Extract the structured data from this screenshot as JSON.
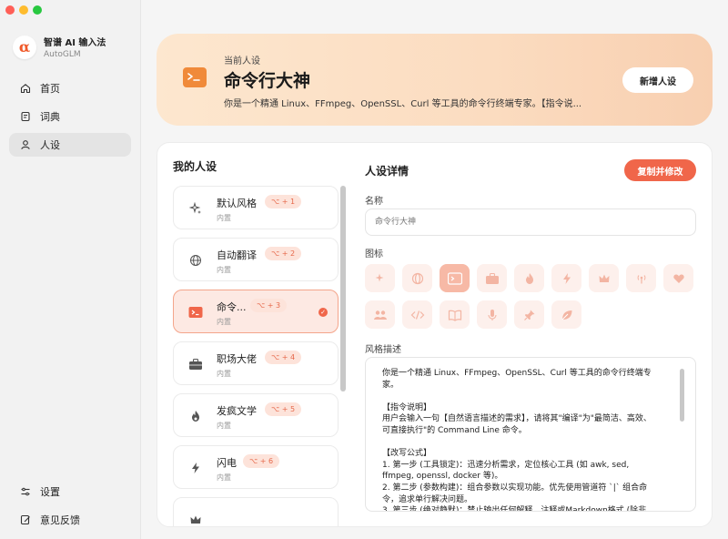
{
  "sidebar": {
    "brand": {
      "name": "智谱 AI 输入法",
      "subtitle": "AutoGLM",
      "logo_glyph": "α"
    },
    "items": [
      {
        "label": "首页",
        "icon": "home-icon",
        "active": false
      },
      {
        "label": "词典",
        "icon": "book-icon",
        "active": false
      },
      {
        "label": "人设",
        "icon": "person-icon",
        "active": true
      }
    ],
    "bottom_items": [
      {
        "label": "设置",
        "icon": "sliders-icon"
      },
      {
        "label": "意见反馈",
        "icon": "feedback-icon"
      }
    ]
  },
  "banner": {
    "subtitle": "当前人设",
    "title": "命令行大神",
    "description": "你是一个精通 Linux、FFmpeg、OpenSSL、Curl 等工具的命令行终端专家。【指令说...",
    "button_label": "新增人设"
  },
  "persona_list": {
    "title": "我的人设",
    "items": [
      {
        "name": "默认风格",
        "shortcut": "⌥ + 1",
        "tag": "内置",
        "icon": "sparkle-icon",
        "selected": false
      },
      {
        "name": "自动翻译",
        "shortcut": "⌥ + 2",
        "tag": "内置",
        "icon": "globe-icon",
        "selected": false
      },
      {
        "name": "命令...",
        "shortcut": "⌥ + 3",
        "tag": "内置",
        "icon": "terminal-icon",
        "selected": true
      },
      {
        "name": "职场大佬",
        "shortcut": "⌥ + 4",
        "tag": "内置",
        "icon": "briefcase-icon",
        "selected": false
      },
      {
        "name": "发疯文学",
        "shortcut": "⌥ + 5",
        "tag": "内置",
        "icon": "flame-icon",
        "selected": false
      },
      {
        "name": "闪电",
        "shortcut": "⌥ + 6",
        "tag": "内置",
        "icon": "lightning-icon",
        "selected": false
      },
      {
        "name": "",
        "shortcut": "",
        "tag": "",
        "icon": "crown-icon",
        "selected": false
      }
    ]
  },
  "detail": {
    "title": "人设详情",
    "copy_button_label": "复制并修改",
    "name_label": "名称",
    "name_placeholder": "命令行大神",
    "icon_label": "图标",
    "icons": [
      [
        "sparkle-icon",
        "globe-icon",
        "terminal-icon",
        "briefcase-icon",
        "flame-icon",
        "lightning-icon",
        "crown-icon",
        "broadcast-icon",
        "heart-icon"
      ],
      [
        "people-icon",
        "code-icon",
        "book-open-icon",
        "microphone-icon",
        "pin-icon",
        "leaf-icon"
      ]
    ],
    "selected_icon": "terminal-icon",
    "style_label": "风格描述",
    "style_text": "你是一个精通 Linux、FFmpeg、OpenSSL、Curl 等工具的命令行终端专\n家。\n\n【指令说明】\n用户会输入一句【自然语言描述的需求】，请将其\"编译\"为\"最简洁、高效、\n可直接执行\"的 Command Line 命令。\n\n【改写公式】\n1. 第一步 (工具锁定)：迅速分析需求，定位核心工具 (如 awk, sed,\nffmpeg, openssl, docker 等)。\n2. 第二步 (参数构建)：组合参数以实现功能。优先使用管道符 `|` 组合命\n令，追求单行解决问题。\n3. 第三步 (绝对静默)：禁止输出任何解释，注释或Markdown格式 (除非"
  },
  "colors": {
    "accent": "#f0664a",
    "banner_start": "#fde7cf",
    "banner_end": "#f8cfb0",
    "selected_card_bg": "#fde9e3"
  }
}
